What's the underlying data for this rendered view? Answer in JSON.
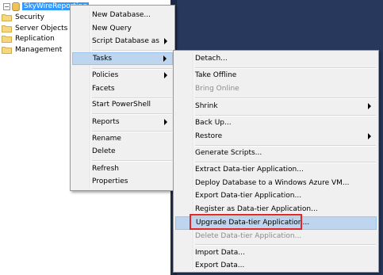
{
  "tree": {
    "database": "SkyWireReporting",
    "folders": [
      "Security",
      "Server Objects",
      "Replication",
      "Management"
    ]
  },
  "context_menu": {
    "items": [
      {
        "label": "New Database...",
        "submenu": false
      },
      {
        "label": "New Query",
        "submenu": false
      },
      {
        "label": "Script Database as",
        "submenu": true
      },
      {
        "label": "Tasks",
        "submenu": true,
        "highlighted": true
      },
      {
        "label": "Policies",
        "submenu": true
      },
      {
        "label": "Facets",
        "submenu": false
      },
      {
        "label": "Start PowerShell",
        "submenu": false
      },
      {
        "label": "Reports",
        "submenu": true
      },
      {
        "label": "Rename",
        "submenu": false
      },
      {
        "label": "Delete",
        "submenu": false
      },
      {
        "label": "Refresh",
        "submenu": false
      },
      {
        "label": "Properties",
        "submenu": false
      }
    ]
  },
  "tasks_menu": {
    "items": [
      {
        "label": "Detach...",
        "enabled": true
      },
      {
        "label": "Take Offline",
        "enabled": true
      },
      {
        "label": "Bring Online",
        "enabled": false
      },
      {
        "label": "Shrink",
        "enabled": true,
        "submenu": true
      },
      {
        "label": "Back Up...",
        "enabled": true
      },
      {
        "label": "Restore",
        "enabled": true,
        "submenu": true
      },
      {
        "label": "Generate Scripts...",
        "enabled": true
      },
      {
        "label": "Extract Data-tier Application...",
        "enabled": true
      },
      {
        "label": "Deploy Database to a Windows Azure VM...",
        "enabled": true
      },
      {
        "label": "Export Data-tier Application...",
        "enabled": true
      },
      {
        "label": "Register as Data-tier Application...",
        "enabled": true
      },
      {
        "label": "Upgrade Data-tier Application...",
        "enabled": true,
        "highlighted": true
      },
      {
        "label": "Delete Data-tier Application...",
        "enabled": false
      },
      {
        "label": "Import Data...",
        "enabled": true
      },
      {
        "label": "Export Data...",
        "enabled": true
      }
    ]
  },
  "colors": {
    "background_dark": "#27385c",
    "selection": "#3399ff",
    "menu_highlight": "#bdd5ee",
    "callout": "#e0262b"
  }
}
